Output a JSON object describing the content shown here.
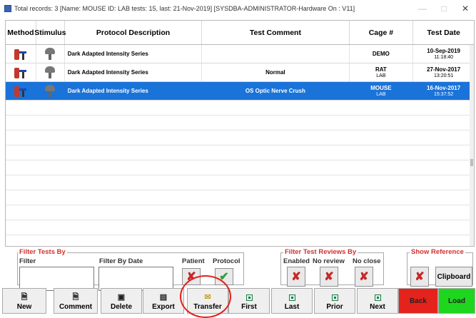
{
  "window": {
    "title": "Total records: 3  [Name:  MOUSE ID: LAB tests: 15, last: 21-Nov-2019] [SYSDBA-ADMINISTRATOR-Hardware On : V11]",
    "minimize": "—",
    "maximize": "□",
    "close": "✕"
  },
  "table": {
    "headers": [
      "Method",
      "Stimulus",
      "Protocol Description",
      "Test Comment",
      "Cage #",
      "Test Date"
    ],
    "rows": [
      {
        "protocol": "Dark Adapted Intensity Series",
        "comment": "",
        "cage": "DEMO",
        "cage_sub": "",
        "date": "10-Sep-2019",
        "time": "11:18:40"
      },
      {
        "protocol": "Dark Adapted Intensity Series",
        "comment": "Normal",
        "cage": "RAT",
        "cage_sub": "LAB",
        "date": "27-Nov-2017",
        "time": "13:20:51"
      },
      {
        "protocol": "Dark Adapted Intensity Series",
        "comment": "OS Optic Nerve Crush",
        "cage": "MOUSE",
        "cage_sub": "LAB",
        "date": "16-Nov-2017",
        "time": "15:37:52"
      }
    ]
  },
  "filters": {
    "group_label": "Filter Tests By",
    "filter_label": "Filter",
    "date_label": "Filter By Date",
    "patient_label": "Patient",
    "protocol_label": "Protocol",
    "review_group_label": "Filter Test Reviews By",
    "enabled_label": "Enabled",
    "no_review_label": "No review",
    "no_close_label": "No close",
    "reference_group_label": "Show Reference",
    "clipboard_label": "Clipboard",
    "x_glyph": "✘",
    "check_glyph": "✔"
  },
  "toolbar": {
    "new": "New",
    "comment": "Comment",
    "delete": "Delete",
    "export": "Export",
    "transfer": "Transfer",
    "first": "First",
    "last": "Last",
    "prior": "Prior",
    "next": "Next",
    "back": "Back",
    "load": "Load"
  },
  "colors": {
    "selected_row": "#1a73d9",
    "group_label_red": "#d32f2f",
    "back_button": "#e4231c",
    "load_button": "#1fd61f",
    "highlight_circle": "#e0201a"
  }
}
